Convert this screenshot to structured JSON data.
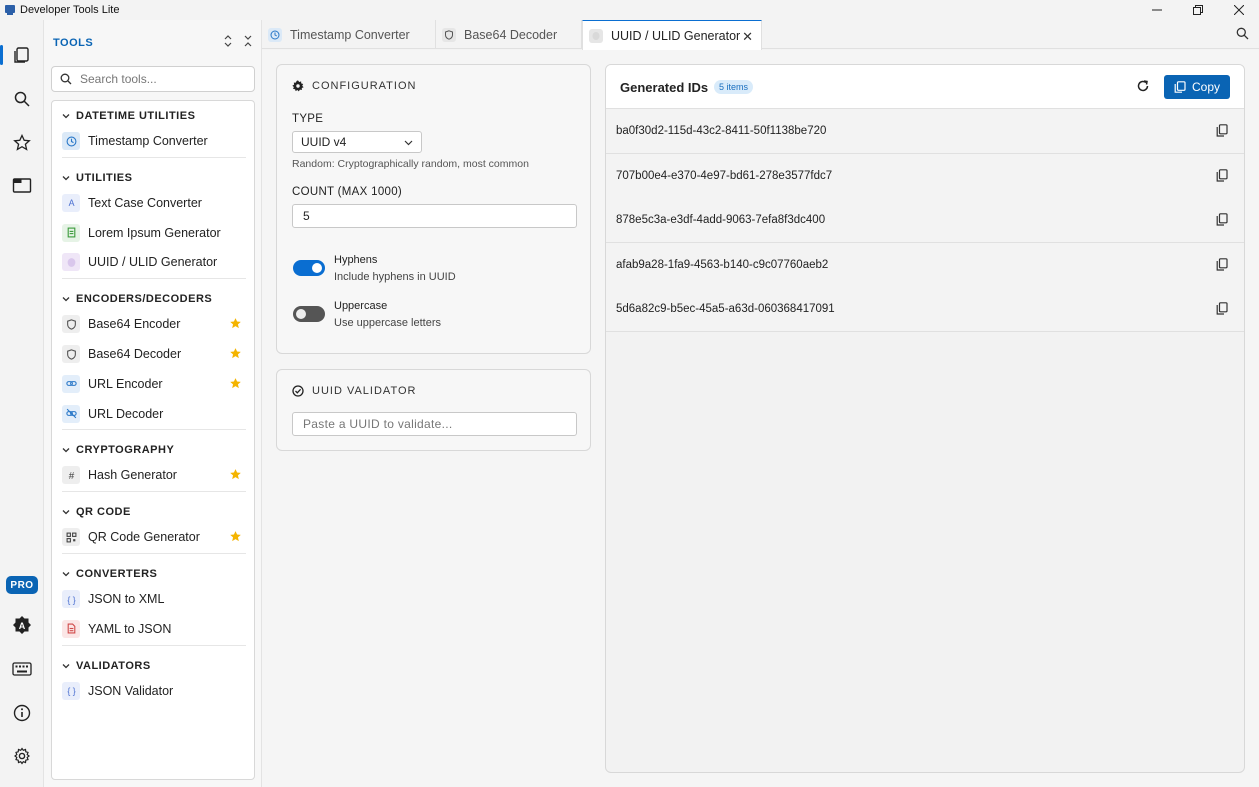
{
  "window": {
    "title": "Developer Tools Lite"
  },
  "activity": {
    "pro_label": "PRO"
  },
  "sidebar": {
    "header": "TOOLS",
    "search_placeholder": "Search tools...",
    "categories": [
      {
        "name": "DATETIME UTILITIES",
        "tools": [
          {
            "name": "Timestamp Converter",
            "icon": "clock-icon",
            "favorite": false
          }
        ]
      },
      {
        "name": "UTILITIES",
        "tools": [
          {
            "name": "Text Case Converter",
            "icon": "text-case-icon",
            "favorite": false
          },
          {
            "name": "Lorem Ipsum Generator",
            "icon": "document-icon",
            "favorite": false
          },
          {
            "name": "UUID / ULID Generator",
            "icon": "fingerprint-icon",
            "favorite": false
          }
        ]
      },
      {
        "name": "ENCODERS/DECODERS",
        "tools": [
          {
            "name": "Base64 Encoder",
            "icon": "shield-icon",
            "favorite": true
          },
          {
            "name": "Base64 Decoder",
            "icon": "shield-icon",
            "favorite": true
          },
          {
            "name": "URL Encoder",
            "icon": "link-icon",
            "favorite": true
          },
          {
            "name": "URL Decoder",
            "icon": "link-off-icon",
            "favorite": false
          }
        ]
      },
      {
        "name": "CRYPTOGRAPHY",
        "tools": [
          {
            "name": "Hash Generator",
            "icon": "hash-icon",
            "favorite": true
          }
        ]
      },
      {
        "name": "QR CODE",
        "tools": [
          {
            "name": "QR Code Generator",
            "icon": "qr-icon",
            "favorite": true
          }
        ]
      },
      {
        "name": "CONVERTERS",
        "tools": [
          {
            "name": "JSON to XML",
            "icon": "braces-icon",
            "favorite": false
          },
          {
            "name": "YAML to JSON",
            "icon": "file-icon",
            "favorite": false
          }
        ]
      },
      {
        "name": "VALIDATORS",
        "tools": [
          {
            "name": "JSON Validator",
            "icon": "braces-icon",
            "favorite": false
          }
        ]
      }
    ]
  },
  "tabs": [
    {
      "label": "Timestamp Converter",
      "active": false
    },
    {
      "label": "Base64 Decoder",
      "active": false
    },
    {
      "label": "UUID / ULID Generator",
      "active": true
    }
  ],
  "config": {
    "title": "CONFIGURATION",
    "type_label": "TYPE",
    "type_value": "UUID v4",
    "type_hint": "Random: Cryptographically random, most common",
    "count_label": "COUNT (MAX 1000)",
    "count_value": "5",
    "hyphens": {
      "title": "Hyphens",
      "desc": "Include hyphens in UUID",
      "on": true
    },
    "uppercase": {
      "title": "Uppercase",
      "desc": "Use uppercase letters",
      "on": false
    }
  },
  "validator": {
    "title": "UUID VALIDATOR",
    "placeholder": "Paste a UUID to validate..."
  },
  "results": {
    "title": "Generated IDs",
    "count_badge": "5 items",
    "copy_label": "Copy",
    "ids": [
      "ba0f30d2-115d-43c2-8411-50f1138be720",
      "707b00e4-e370-4e97-bd61-278e3577fdc7",
      "878e5c3a-e3df-4add-9063-7efa8f3dc400",
      "afab9a28-1fa9-4563-b140-c9c07760aeb2",
      "5d6a82c9-b5ec-45a5-a63d-060368417091"
    ]
  },
  "colors": {
    "accent": "#0a64b4",
    "star": "#f4b400",
    "active_border": "#0a6ed1"
  }
}
